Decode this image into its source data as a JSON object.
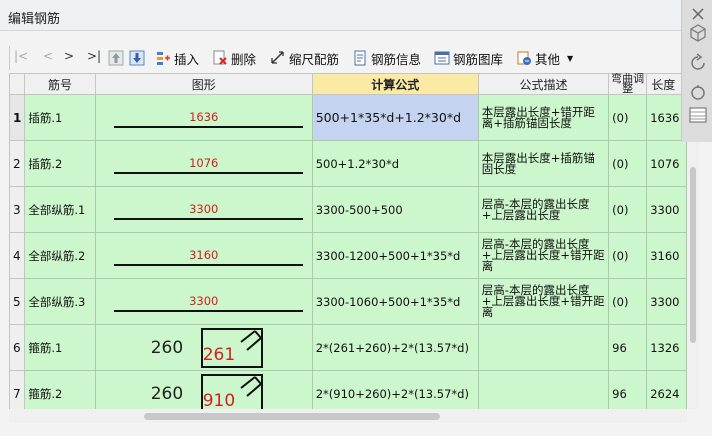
{
  "window": {
    "title": "编辑钢筋"
  },
  "toolbar": {
    "nav_first": "|<",
    "nav_prev": "<",
    "nav_next": ">",
    "nav_last": ">|",
    "insert": "插入",
    "delete": "删除",
    "scale_rebar": "缩尺配筋",
    "rebar_info": "钢筋信息",
    "rebar_library": "钢筋图库",
    "other": "其他"
  },
  "table": {
    "columns": {
      "bar_no": "筋号",
      "shape": "图形",
      "formula": "计算公式",
      "desc": "公式描述",
      "bend": "弯曲调整",
      "length": "长度"
    },
    "rows": [
      {
        "no": "1",
        "name": "插筋.1",
        "shape_type": "line",
        "shape_value": "1636",
        "formula": "500+1*35*d+1.2*30*d",
        "desc": "本层露出长度+错开距离+插筋锚固长度",
        "bend": "(0)",
        "length": "1636",
        "selected": true
      },
      {
        "no": "2",
        "name": "插筋.2",
        "shape_type": "line",
        "shape_value": "1076",
        "formula": "500+1.2*30*d",
        "desc": "本层露出长度+插筋锚固长度",
        "bend": "(0)",
        "length": "1076"
      },
      {
        "no": "3",
        "name": "全部纵筋.1",
        "shape_type": "line",
        "shape_value": "3300",
        "formula": "3300-500+500",
        "desc": "层高-本层的露出长度+上层露出长度",
        "bend": "(0)",
        "length": "3300"
      },
      {
        "no": "4",
        "name": "全部纵筋.2",
        "shape_type": "line",
        "shape_value": "3160",
        "formula": "3300-1200+500+1*35*d",
        "desc": "层高-本层的露出长度+上层露出长度+错开距离",
        "bend": "(0)",
        "length": "3160"
      },
      {
        "no": "5",
        "name": "全部纵筋.3",
        "shape_type": "line",
        "shape_value": "3300",
        "formula": "3300-1060+500+1*35*d",
        "desc": "层高-本层的露出长度+上层露出长度+错开距离",
        "bend": "(0)",
        "length": "3300"
      },
      {
        "no": "6",
        "name": "箍筋.1",
        "shape_type": "stirrup",
        "shape_a": "260",
        "shape_b": "261",
        "formula": "2*(261+260)+2*(13.57*d)",
        "desc": "",
        "bend": "96",
        "length": "1326"
      },
      {
        "no": "7",
        "name": "箍筋.2",
        "shape_type": "stirrup",
        "shape_a": "260",
        "shape_b": "910",
        "formula": "2*(910+260)+2*(13.57*d)",
        "desc": "",
        "bend": "96",
        "length": "2624"
      }
    ]
  },
  "colors": {
    "row_bg": "#ccf6cc",
    "selected_cell": "#c4d3ef",
    "active_header": "#fbe9a6",
    "shape_number": "#d31f1f"
  }
}
